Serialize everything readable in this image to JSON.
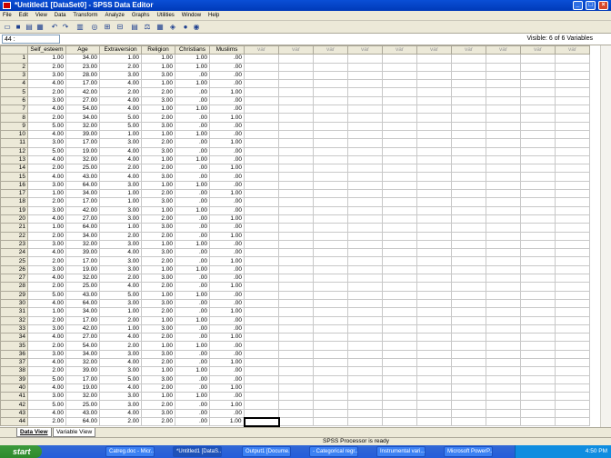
{
  "window": {
    "title": "*Untitled1 [DataSet0] - SPSS Data Editor",
    "min": "_",
    "max": "□",
    "close": "×"
  },
  "menu": [
    "File",
    "Edit",
    "View",
    "Data",
    "Transform",
    "Analyze",
    "Graphs",
    "Utilities",
    "Window",
    "Help"
  ],
  "cellbar": {
    "ref": "44 :",
    "visible": "Visible: 6 of 6 Variables"
  },
  "columns": [
    "Self_esteem",
    "Age",
    "Extraversion",
    "Religion",
    "Christians",
    "Muslims"
  ],
  "var_label": "var",
  "rows": [
    [
      "1",
      "1.00",
      "34.00",
      "1.00",
      "1.00",
      "1.00",
      ".00"
    ],
    [
      "2",
      "2.00",
      "23.00",
      "2.00",
      "1.00",
      "1.00",
      ".00"
    ],
    [
      "3",
      "3.00",
      "28.00",
      "3.00",
      "3.00",
      ".00",
      ".00"
    ],
    [
      "4",
      "4.00",
      "17.00",
      "4.00",
      "1.00",
      "1.00",
      ".00"
    ],
    [
      "5",
      "2.00",
      "42.00",
      "2.00",
      "2.00",
      ".00",
      "1.00"
    ],
    [
      "6",
      "3.00",
      "27.00",
      "4.00",
      "3.00",
      ".00",
      ".00"
    ],
    [
      "7",
      "4.00",
      "54.00",
      "4.00",
      "1.00",
      "1.00",
      ".00"
    ],
    [
      "8",
      "2.00",
      "34.00",
      "5.00",
      "2.00",
      ".00",
      "1.00"
    ],
    [
      "9",
      "5.00",
      "32.00",
      "5.00",
      "3.00",
      ".00",
      ".00"
    ],
    [
      "10",
      "4.00",
      "39.00",
      "1.00",
      "1.00",
      "1.00",
      ".00"
    ],
    [
      "11",
      "3.00",
      "17.00",
      "3.00",
      "2.00",
      ".00",
      "1.00"
    ],
    [
      "12",
      "5.00",
      "19.00",
      "4.00",
      "3.00",
      ".00",
      ".00"
    ],
    [
      "13",
      "4.00",
      "32.00",
      "4.00",
      "1.00",
      "1.00",
      ".00"
    ],
    [
      "14",
      "2.00",
      "25.00",
      "2.00",
      "2.00",
      ".00",
      "1.00"
    ],
    [
      "15",
      "4.00",
      "43.00",
      "4.00",
      "3.00",
      ".00",
      ".00"
    ],
    [
      "16",
      "3.00",
      "64.00",
      "3.00",
      "1.00",
      "1.00",
      ".00"
    ],
    [
      "17",
      "1.00",
      "34.00",
      "1.00",
      "2.00",
      ".00",
      "1.00"
    ],
    [
      "18",
      "2.00",
      "17.00",
      "1.00",
      "3.00",
      ".00",
      ".00"
    ],
    [
      "19",
      "3.00",
      "42.00",
      "3.00",
      "1.00",
      "1.00",
      ".00"
    ],
    [
      "20",
      "4.00",
      "27.00",
      "3.00",
      "2.00",
      ".00",
      "1.00"
    ],
    [
      "21",
      "1.00",
      "64.00",
      "1.00",
      "3.00",
      ".00",
      ".00"
    ],
    [
      "22",
      "2.00",
      "34.00",
      "2.00",
      "2.00",
      ".00",
      "1.00"
    ],
    [
      "23",
      "3.00",
      "32.00",
      "3.00",
      "1.00",
      "1.00",
      ".00"
    ],
    [
      "24",
      "4.00",
      "39.00",
      "4.00",
      "3.00",
      ".00",
      ".00"
    ],
    [
      "25",
      "2.00",
      "17.00",
      "3.00",
      "2.00",
      ".00",
      "1.00"
    ],
    [
      "26",
      "3.00",
      "19.00",
      "3.00",
      "1.00",
      "1.00",
      ".00"
    ],
    [
      "27",
      "4.00",
      "32.00",
      "2.00",
      "3.00",
      ".00",
      ".00"
    ],
    [
      "28",
      "2.00",
      "25.00",
      "4.00",
      "2.00",
      ".00",
      "1.00"
    ],
    [
      "29",
      "5.00",
      "43.00",
      "5.00",
      "1.00",
      "1.00",
      ".00"
    ],
    [
      "30",
      "4.00",
      "64.00",
      "3.00",
      "3.00",
      ".00",
      ".00"
    ],
    [
      "31",
      "1.00",
      "34.00",
      "1.00",
      "2.00",
      ".00",
      "1.00"
    ],
    [
      "32",
      "2.00",
      "17.00",
      "2.00",
      "1.00",
      "1.00",
      ".00"
    ],
    [
      "33",
      "3.00",
      "42.00",
      "1.00",
      "3.00",
      ".00",
      ".00"
    ],
    [
      "34",
      "4.00",
      "27.00",
      "4.00",
      "2.00",
      ".00",
      "1.00"
    ],
    [
      "35",
      "2.00",
      "54.00",
      "2.00",
      "1.00",
      "1.00",
      ".00"
    ],
    [
      "36",
      "3.00",
      "34.00",
      "3.00",
      "3.00",
      ".00",
      ".00"
    ],
    [
      "37",
      "4.00",
      "32.00",
      "4.00",
      "2.00",
      ".00",
      "1.00"
    ],
    [
      "38",
      "2.00",
      "39.00",
      "3.00",
      "1.00",
      "1.00",
      ".00"
    ],
    [
      "39",
      "5.00",
      "17.00",
      "5.00",
      "3.00",
      ".00",
      ".00"
    ],
    [
      "40",
      "4.00",
      "19.00",
      "4.00",
      "2.00",
      ".00",
      "1.00"
    ],
    [
      "41",
      "3.00",
      "32.00",
      "3.00",
      "1.00",
      "1.00",
      ".00"
    ],
    [
      "42",
      "5.00",
      "25.00",
      "3.00",
      "2.00",
      ".00",
      "1.00"
    ],
    [
      "43",
      "4.00",
      "43.00",
      "4.00",
      "3.00",
      ".00",
      ".00"
    ],
    [
      "44",
      "2.00",
      "64.00",
      "2.00",
      "2.00",
      ".00",
      "1.00"
    ]
  ],
  "tabs": {
    "data_view": "Data View",
    "variable_view": "Variable View"
  },
  "status": "SPSS Processor is ready",
  "taskbar": {
    "start": "start",
    "items": [
      "Catreg.doc - Micr...",
      "*Untitled1 [DataS...",
      "Output1 [Docume...",
      "- Categorical regr...",
      "Instrumental vari...",
      "Microsoft PowerP..."
    ],
    "clock": "4:50 PM"
  }
}
